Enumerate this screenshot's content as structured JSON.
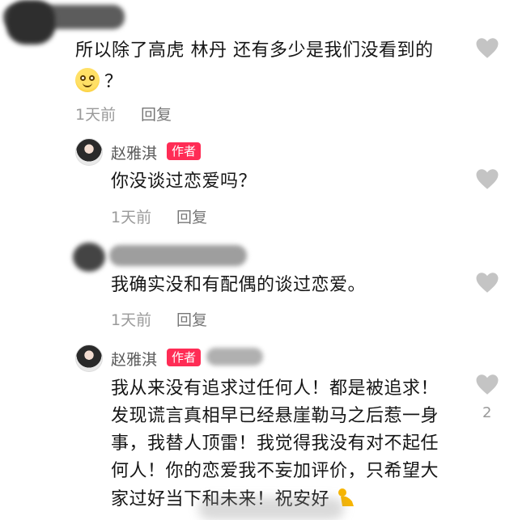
{
  "comments": [
    {
      "text_line1": "所以除了高虎 林丹 还有多少是我们没看到的",
      "text_line2": "？",
      "time": "1天前",
      "reply_label": "回复"
    }
  ],
  "replies": [
    {
      "author": "赵雅淇",
      "badge": "作者",
      "text": "你没谈过恋爱吗？",
      "time": "1天前",
      "reply_label": "回复"
    },
    {
      "text": "我确实没和有配偶的谈过恋爱。",
      "time": "1天前",
      "reply_label": "回复"
    },
    {
      "author": "赵雅淇",
      "badge": "作者",
      "lines": [
        "我从来没有追求过任何人！都是被追求！",
        "发现谎言真相早已经悬崖勒马之后惹一身",
        "事，我替人顶雷！我觉得我没有对不起任",
        "何人！你的恋爱我不妄加评价，只希望大",
        "家过好当下和未来！祝安好"
      ],
      "like_count": "2"
    }
  ],
  "colors": {
    "badge": "#ff2c55",
    "meta": "#9a9a9a",
    "heart": "#bdbdbd"
  },
  "icons": {
    "like": "heart-outline-icon",
    "smile": "smiling-face-emoji",
    "bow": "bowing-emoji"
  }
}
